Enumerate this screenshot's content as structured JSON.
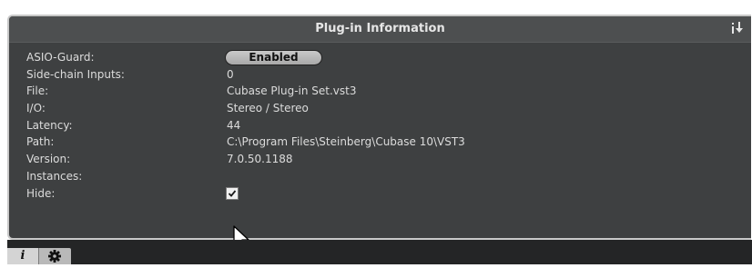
{
  "header": {
    "title": "Plug-in Information",
    "export_icon": "export-info-icon"
  },
  "rows": [
    {
      "label": "ASIO-Guard:",
      "value": "Enabled",
      "kind": "toggle-button"
    },
    {
      "label": "Side-chain Inputs:",
      "value": "0"
    },
    {
      "label": "File:",
      "value": "Cubase Plug-in Set.vst3"
    },
    {
      "label": "I/O:",
      "value": "Stereo / Stereo"
    },
    {
      "label": "Latency:",
      "value": "44"
    },
    {
      "label": "Path:",
      "value": "C:\\Program Files\\Steinberg\\Cubase 10\\VST3"
    },
    {
      "label": "Version:",
      "value": "7.0.50.1188"
    },
    {
      "label": "Instances:",
      "value": ""
    },
    {
      "label": "Hide:",
      "value": "",
      "kind": "checkbox",
      "checked": true
    }
  ],
  "tabs": {
    "info_glyph": "i",
    "info_icon": "info-icon",
    "settings_icon": "gear-icon"
  },
  "colors": {
    "panel_bg": "#3e4041",
    "title_bg": "#4d4f50",
    "text": "#dcdcdc",
    "bottom_bar": "#242526"
  }
}
